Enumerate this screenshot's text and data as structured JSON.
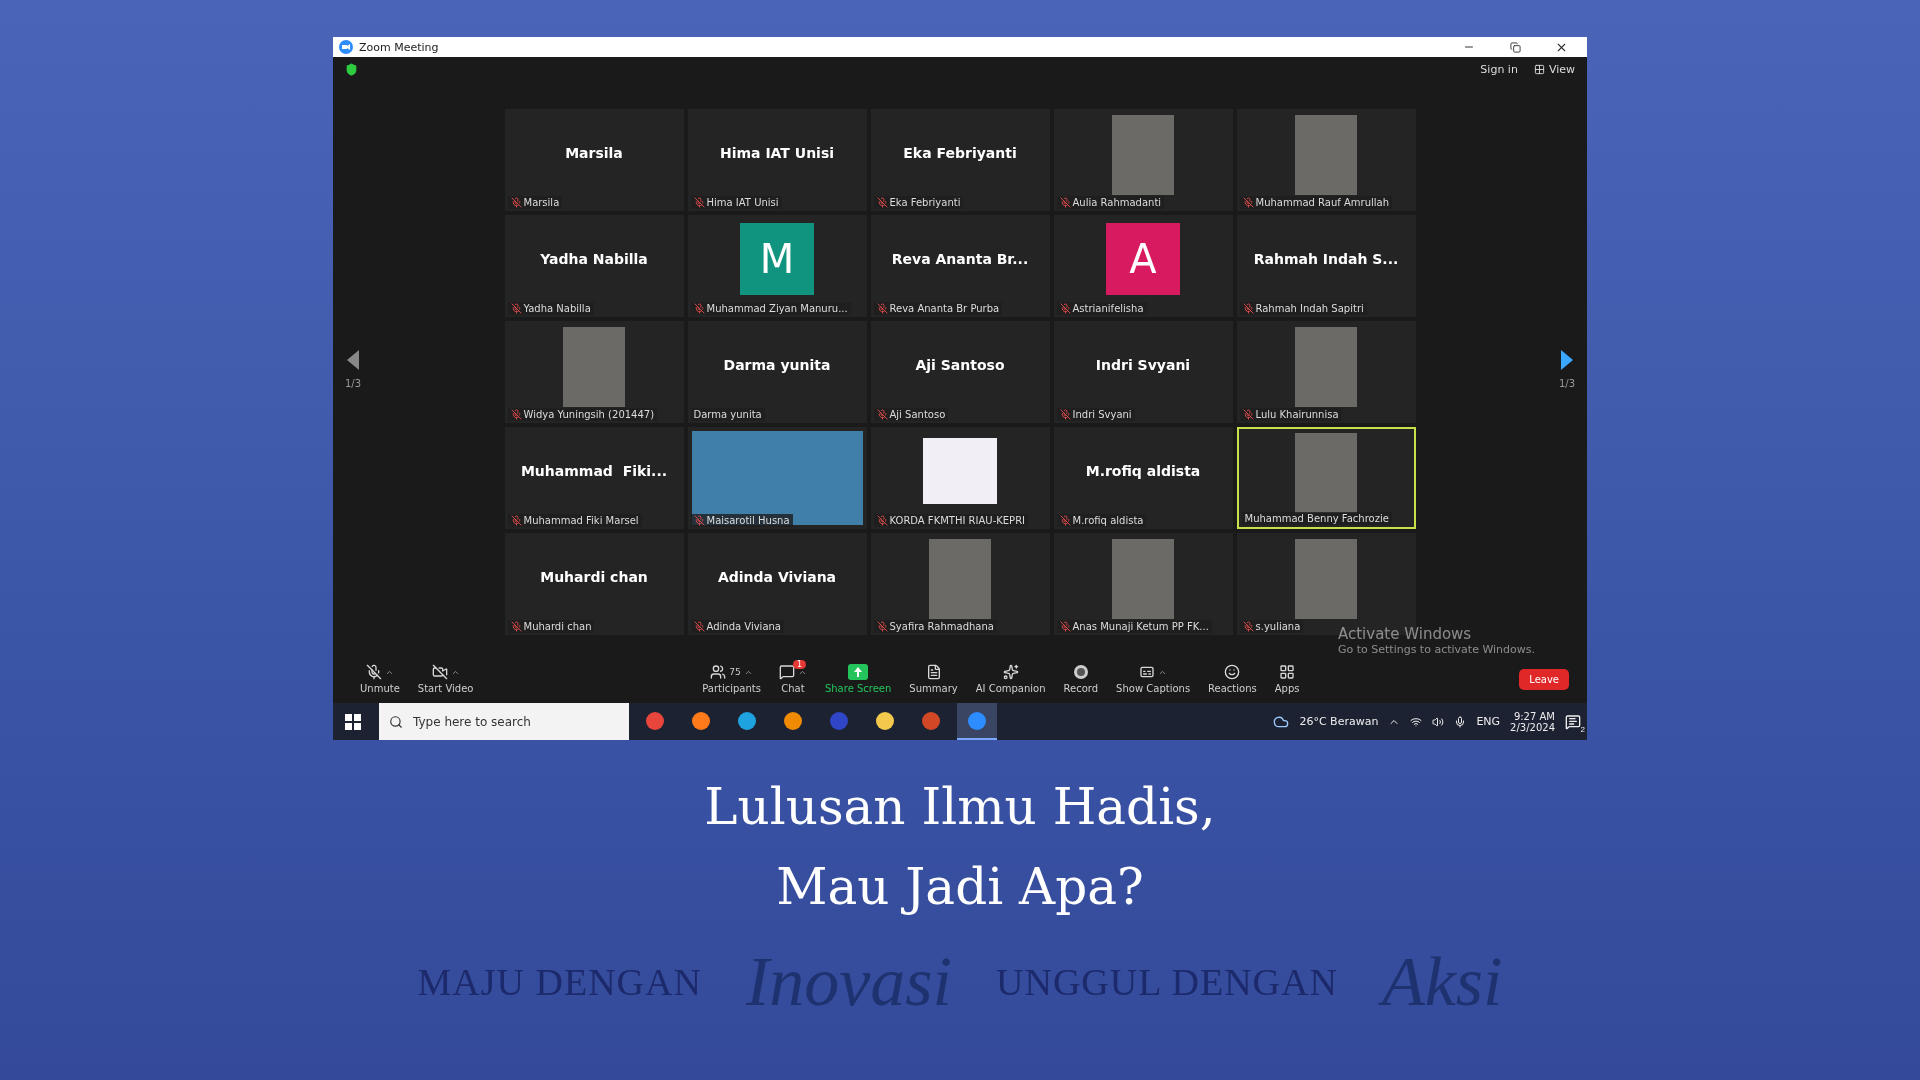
{
  "window": {
    "title": "Zoom Meeting"
  },
  "top_bar": {
    "sign_in": "Sign in",
    "view": "View"
  },
  "pager": {
    "left": "1/3",
    "right": "1/3"
  },
  "tiles": [
    {
      "kind": "name",
      "display": "Marsila",
      "label": "Marsila",
      "muted": true,
      "speaking": false
    },
    {
      "kind": "name",
      "display": "Hima IAT Unisi",
      "label": "Hima IAT Unisi",
      "muted": true,
      "speaking": false
    },
    {
      "kind": "name",
      "display": "Eka Febriyanti",
      "label": "Eka Febriyanti",
      "muted": true,
      "speaking": false
    },
    {
      "kind": "photo",
      "label": "Aulia Rahmadanti",
      "muted": true,
      "speaking": false
    },
    {
      "kind": "photo",
      "label": "Muhammad Rauf Amrullah",
      "muted": true,
      "speaking": false
    },
    {
      "kind": "name",
      "display": "Yadha Nabilla",
      "label": "Yadha Nabilla",
      "muted": true,
      "speaking": false
    },
    {
      "kind": "avatar",
      "display": "M",
      "color": "#11947f",
      "label": "Muhammad Ziyan Manuru...",
      "muted": true,
      "speaking": false
    },
    {
      "kind": "name",
      "display": "Reva Ananta Br...",
      "label": "Reva Ananta Br Purba",
      "muted": true,
      "speaking": false
    },
    {
      "kind": "avatar",
      "display": "A",
      "color": "#d81b60",
      "label": "Astrianifelisha",
      "muted": true,
      "speaking": false
    },
    {
      "kind": "name",
      "display": "Rahmah Indah S...",
      "label": "Rahmah Indah Sapitri",
      "muted": true,
      "speaking": false
    },
    {
      "kind": "photo",
      "label": "Widya Yuningsih (201447)",
      "muted": true,
      "speaking": false
    },
    {
      "kind": "name",
      "display": "Darma yunita",
      "label": "Darma yunita",
      "muted": false,
      "speaking": false
    },
    {
      "kind": "name",
      "display": "Aji Santoso",
      "label": "Aji Santoso",
      "muted": true,
      "speaking": false
    },
    {
      "kind": "name",
      "display": "Indri Svyani",
      "label": "Indri Svyani",
      "muted": true,
      "speaking": false
    },
    {
      "kind": "photo",
      "label": "Lulu Khairunnisa",
      "muted": true,
      "speaking": false
    },
    {
      "kind": "name",
      "display": "Muhammad  Fiki...",
      "label": "Muhammad Fiki Marsel",
      "muted": true,
      "speaking": false
    },
    {
      "kind": "video",
      "label": "Maisarotil Husna",
      "muted": true,
      "speaking": false
    },
    {
      "kind": "logo",
      "label": "KORDA FKMTHI RIAU-KEPRI",
      "muted": true,
      "speaking": false
    },
    {
      "kind": "name",
      "display": "M.rofiq aldista",
      "label": "M.rofiq aldista",
      "muted": true,
      "speaking": false
    },
    {
      "kind": "photo",
      "label": "Muhammad Benny Fachrozie",
      "muted": false,
      "speaking": true
    },
    {
      "kind": "name",
      "display": "Muhardi chan",
      "label": "Muhardi chan",
      "muted": true,
      "speaking": false
    },
    {
      "kind": "name",
      "display": "Adinda Viviana",
      "label": "Adinda Viviana",
      "muted": true,
      "speaking": false
    },
    {
      "kind": "photo",
      "label": "Syafira Rahmadhana",
      "muted": true,
      "speaking": false
    },
    {
      "kind": "photo",
      "label": "Anas Munaji Ketum PP FK...",
      "muted": true,
      "speaking": false
    },
    {
      "kind": "photo",
      "label": "s.yuliana",
      "muted": true,
      "speaking": false
    }
  ],
  "toolbar": {
    "left": [
      {
        "kind": "mic",
        "label": "Unmute"
      },
      {
        "kind": "video",
        "label": "Start Video"
      }
    ],
    "center": [
      {
        "kind": "participants",
        "label": "Participants",
        "count": "75",
        "caret": true
      },
      {
        "kind": "chat",
        "label": "Chat",
        "badge": "1",
        "caret": true
      },
      {
        "kind": "share",
        "label": "Share Screen",
        "caret": false
      },
      {
        "kind": "summary",
        "label": "Summary",
        "caret": false
      },
      {
        "kind": "ai",
        "label": "AI Companion",
        "caret": false
      },
      {
        "kind": "record",
        "label": "Record",
        "caret": false
      },
      {
        "kind": "captions",
        "label": "Show Captions",
        "caret": true
      },
      {
        "kind": "reactions",
        "label": "Reactions",
        "caret": false
      },
      {
        "kind": "apps",
        "label": "Apps",
        "caret": false
      }
    ],
    "leave": "Leave"
  },
  "activation": {
    "title": "Activate Windows",
    "text": "Go to Settings to activate Windows."
  },
  "taskbar": {
    "search_placeholder": "Type here to search",
    "apps": [
      {
        "color": "#e8453c",
        "selected": false
      },
      {
        "color": "#ff7a1a",
        "selected": false
      },
      {
        "color": "#1fa3e0",
        "selected": false
      },
      {
        "color": "#f08a00",
        "selected": false
      },
      {
        "color": "#3046c8",
        "selected": false
      },
      {
        "color": "#f2c94c",
        "selected": false
      },
      {
        "color": "#d24726",
        "selected": false
      },
      {
        "color": "#2d8cff",
        "selected": true
      }
    ],
    "weather": "26°C  Berawan",
    "language": "ENG",
    "time": "9:27 AM",
    "date": "2/3/2024",
    "notifications": "2"
  },
  "poster": {
    "title_lines": [
      "Lulusan Ilmu Hadis,",
      "Mau Jadi Apa?"
    ],
    "tagline": [
      {
        "kind": "caps",
        "text": "MAJU DENGAN"
      },
      {
        "kind": "script",
        "text": "Inovasi"
      },
      {
        "kind": "caps",
        "text": "UNGGUL DENGAN"
      },
      {
        "kind": "script",
        "text": "Aksi"
      }
    ]
  }
}
